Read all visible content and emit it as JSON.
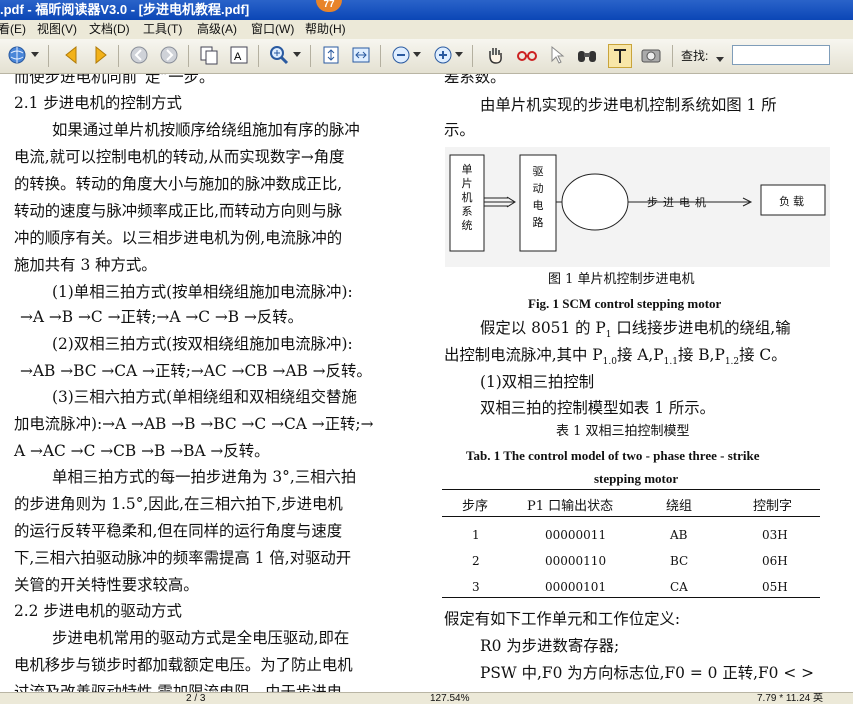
{
  "window": {
    "title": ".pdf - 福昕阅读器V3.0 - [步进电机教程.pdf]",
    "badge": "77"
  },
  "menu": {
    "items": [
      "看(E)",
      "视图(V)",
      "文档(D)",
      "工具(T)",
      "高级(A)",
      "窗口(W)",
      "帮助(H)"
    ]
  },
  "toolbar": {
    "find_label": "查找:",
    "find_value": ""
  },
  "left_column": {
    "top_fragment": "而使步进电机向前“走”一步。",
    "heading_21": "2.1  步进电机的控制方式",
    "para1": [
      "如果通过单片机按顺序给绕组施加有序的脉冲",
      "电流,就可以控制电机的转动,从而实现数字→角度",
      "的转换。转动的角度大小与施加的脉冲数成正比,",
      "转动的速度与脉冲频率成正比,而转动方向则与脉",
      "冲的顺序有关。以三相步进电机为例,电流脉冲的",
      "施加共有 3 种方式。"
    ],
    "mode1_title": "(1)单相三拍方式(按单相绕组施加电流脉冲):",
    "mode1_seq": "→A →B →C →正转;→A →C →B →反转。",
    "mode2_title": "(2)双相三拍方式(按双相绕组施加电流脉冲):",
    "mode2_seq": "→AB →BC →CA →正转;→AC →CB →AB →反转。",
    "mode3_title": "(3)三相六拍方式(单相绕组和双相绕组交替施",
    "mode3_line2": "加电流脉冲):→A →AB →B →BC →C →CA →正转;→",
    "mode3_line3": "A →AC →C →CB →B →BA →反转。",
    "para2": [
      "单相三拍方式的每一拍步进角为 3°,三相六拍",
      "的步进角则为 1.5°,因此,在三相六拍下,步进电机",
      "的运行反转平稳柔和,但在同样的运行角度与速度",
      "下,三相六拍驱动脉冲的频率需提高 1 倍,对驱动开",
      "关管的开关特性要求较高。"
    ],
    "heading_22": "2.2  步进电机的驱动方式",
    "para3": [
      "步进电机常用的驱动方式是全电压驱动,即在",
      "电机移步与锁步时都加载额定电压。为了防止电机",
      "过流及改善驱动特性,需加限流电阻。由于步进电"
    ]
  },
  "right_column": {
    "top_fragment": "差系数。",
    "intro": [
      "由单片机实现的步进电机控制系统如图 1 所",
      "示。"
    ],
    "figure": {
      "box_scm": "单片机系统",
      "box_driver": "驱动电路",
      "motor_label": "步进电机",
      "box_load": "负载",
      "caption_cn": "图 1   单片机控制步进电机",
      "caption_en": "Fig. 1   SCM control stepping motor"
    },
    "para_p1": [
      "假定以 8051 的 P",
      "出控制电流脉冲,其中 P",
      "接 A,P",
      "接 B,P",
      "接 C。"
    ],
    "para_p1_parts": {
      "l1_a": "假定以 8051 的 P",
      "l1_sub": "1",
      "l1_b": " 口线接步进电机的绕组,输",
      "l2_a": "出控制电流脉冲,其中 P",
      "l2_sub1": "1.0",
      "l2_b": "接 A,P",
      "l2_sub2": "1.1",
      "l2_c": "接 B,P",
      "l2_sub3": "1.2",
      "l2_d": "接 C。"
    },
    "sub_heading": "(1)双相三拍控制",
    "model_line": "双相三拍的控制模型如表 1 所示。",
    "table": {
      "caption_cn": "表 1   双相三拍控制模型",
      "caption_en_1": "Tab. 1    The control model of two - phase three - strike",
      "caption_en_2": "stepping motor",
      "headers": [
        "步序",
        "P1 口输出状态",
        "绕组",
        "控制字"
      ],
      "rows": [
        [
          "1",
          "00000011",
          "AB",
          "03H"
        ],
        [
          "2",
          "00000110",
          "BC",
          "06H"
        ],
        [
          "3",
          "00000101",
          "CA",
          "05H"
        ]
      ]
    },
    "define_line": "假定有如下工作单元和工作位定义:",
    "r0_line": "R0 为步进数寄存器;",
    "psw_line": "PSW 中,F0 为方向标志位,F0 = 0 正转,F0 < >"
  },
  "status": {
    "page": "2 / 3",
    "zoom": "127.54%",
    "size": "7.79 * 11.24 英"
  }
}
